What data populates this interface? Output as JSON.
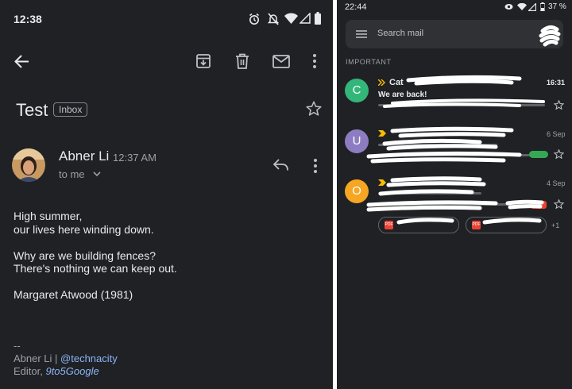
{
  "left": {
    "status_bar": {
      "time": "12:38"
    },
    "message": {
      "subject": "Test",
      "label": "Inbox",
      "sender": "Abner Li",
      "time": "12:37 AM",
      "recipient": "to me"
    },
    "body": [
      "High summer,",
      "our lives here winding down.",
      "Why are we building fences?",
      "There's nothing we can keep out.",
      "Margaret Atwood (1981)"
    ],
    "signature": {
      "dashes": "--",
      "name_prefix": "Abner Li | ",
      "twitter": "@technacity",
      "role_prefix": "Editor, ",
      "publication": "9to5Google"
    },
    "icons": [
      "back-arrow-icon",
      "archive-icon",
      "delete-icon",
      "mail-icon",
      "more-vert-icon",
      "star-icon",
      "reply-icon",
      "chevron-down-icon",
      "alarm-icon",
      "dnd-icon",
      "wifi-icon",
      "signal-icon",
      "battery-icon"
    ]
  },
  "right": {
    "status_bar": {
      "time": "22:44",
      "battery": "37 %"
    },
    "search": {
      "placeholder": "Search mail"
    },
    "section_label": "IMPORTANT",
    "emails": [
      {
        "avatar_letter": "C",
        "avatar_color": "#33b679",
        "sender_fragment": "Cat",
        "subject": "We are back!",
        "date": "16:31"
      },
      {
        "avatar_letter": "U",
        "avatar_color": "#8e7cc3",
        "date": "6 Sep"
      },
      {
        "avatar_letter": "O",
        "avatar_color": "#f6a623",
        "date": "4 Sep",
        "more_attachments": "+1"
      }
    ],
    "icons": [
      "menu-icon",
      "star-icon",
      "importance-marker-icon",
      "pdf-icon"
    ]
  },
  "colors": {
    "background": "#202124",
    "text": "#e8eaed",
    "muted": "#9aa0a6",
    "link": "#8ab4f8",
    "importance": "#fbbc04"
  }
}
